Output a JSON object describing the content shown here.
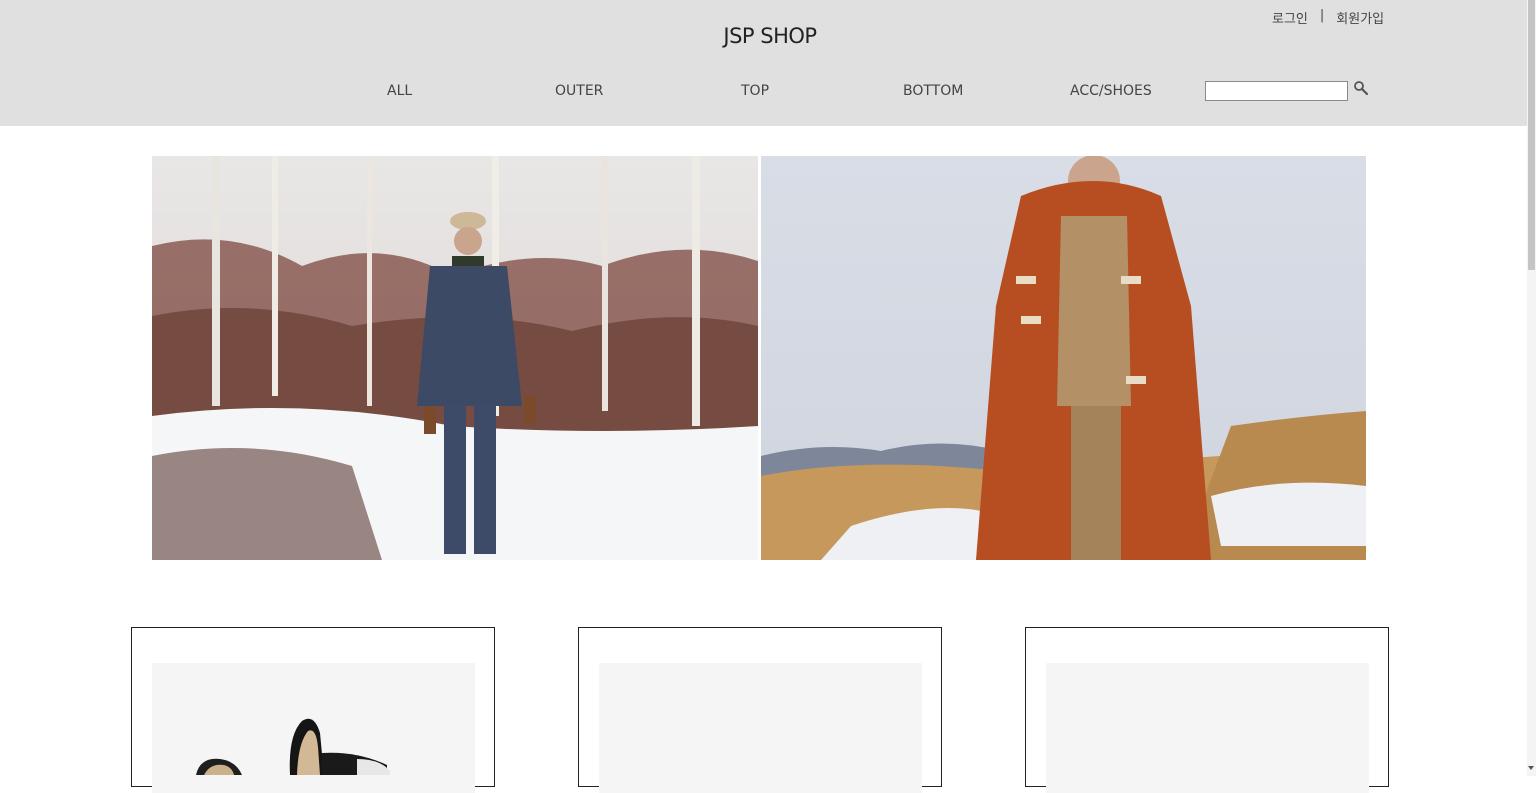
{
  "header": {
    "logo": "JSP SHOP",
    "auth": {
      "login": "로그인",
      "separator": "|",
      "signup": "회원가입"
    },
    "nav": [
      {
        "label": "ALL"
      },
      {
        "label": "OUTER"
      },
      {
        "label": "TOP"
      },
      {
        "label": "BOTTOM"
      },
      {
        "label": "ACC/SHOES"
      }
    ],
    "search": {
      "value": "",
      "placeholder": "",
      "icon": "search-icon"
    }
  },
  "banner": {
    "images": [
      {
        "icon": "model-in-snowy-forest-photo"
      },
      {
        "icon": "model-in-orange-duffle-coat-photo"
      }
    ]
  },
  "products": [
    {
      "icon": "loafer-shoes-photo"
    },
    {
      "icon": "product-photo-placeholder"
    },
    {
      "icon": "product-photo-placeholder"
    }
  ],
  "colors": {
    "header_bg": "#e0e0e0",
    "thumb_bg": "#f5f5f5"
  }
}
